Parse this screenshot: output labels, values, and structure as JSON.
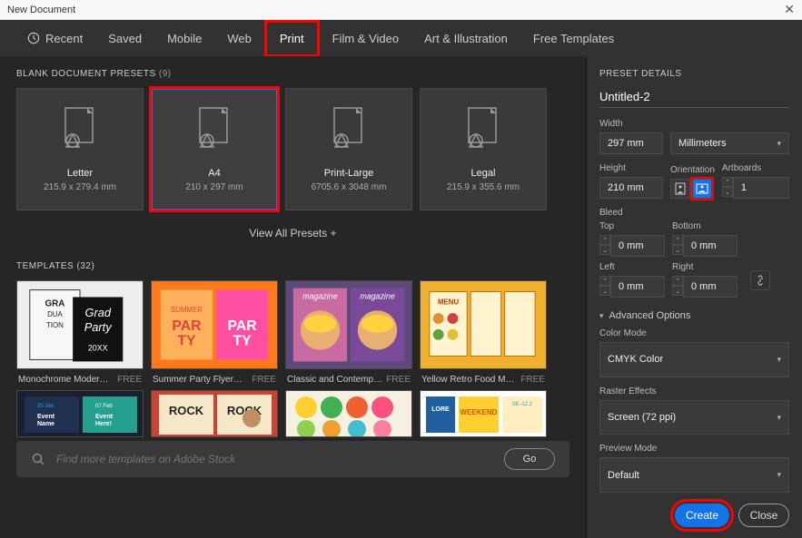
{
  "window": {
    "title": "New Document",
    "close_glyph": "✕"
  },
  "tabs": {
    "recent": "Recent",
    "saved": "Saved",
    "mobile": "Mobile",
    "web": "Web",
    "print": "Print",
    "film": "Film & Video",
    "art": "Art & Illustration",
    "free": "Free Templates"
  },
  "presets_section": {
    "label": "BLANK DOCUMENT PRESETS",
    "count": "(9)"
  },
  "presets": [
    {
      "name": "Letter",
      "dim": "215.9 x 279.4 mm"
    },
    {
      "name": "A4",
      "dim": "210 x 297 mm"
    },
    {
      "name": "Print-Large",
      "dim": "6705.6 x 3048 mm"
    },
    {
      "name": "Legal",
      "dim": "215.9 x 355.6 mm"
    }
  ],
  "view_all": "View All Presets +",
  "templates_section": {
    "label": "TEMPLATES",
    "count": "(32)"
  },
  "templates": [
    {
      "name": "Monochrome Moder…",
      "badge": "FREE"
    },
    {
      "name": "Summer Party Flyer…",
      "badge": "FREE"
    },
    {
      "name": "Classic and Contemp…",
      "badge": "FREE"
    },
    {
      "name": "Yellow Retro Food M…",
      "badge": "FREE"
    }
  ],
  "search": {
    "placeholder": "Find more templates on Adobe Stock",
    "go": "Go"
  },
  "details": {
    "title": "PRESET DETAILS",
    "doc_name": "Untitled-2",
    "width_label": "Width",
    "width_value": "297 mm",
    "units": "Millimeters",
    "height_label": "Height",
    "height_value": "210 mm",
    "orientation_label": "Orientation",
    "artboards_label": "Artboards",
    "artboards_value": "1",
    "bleed_label": "Bleed",
    "top_label": "Top",
    "top_value": "0 mm",
    "bottom_label": "Bottom",
    "bottom_value": "0 mm",
    "left_label": "Left",
    "left_value": "0 mm",
    "right_label": "Right",
    "right_value": "0 mm",
    "advanced": "Advanced Options",
    "color_mode_label": "Color Mode",
    "color_mode_value": "CMYK Color",
    "raster_label": "Raster Effects",
    "raster_value": "Screen (72 ppi)",
    "preview_label": "Preview Mode",
    "preview_value": "Default",
    "create": "Create",
    "close": "Close"
  }
}
